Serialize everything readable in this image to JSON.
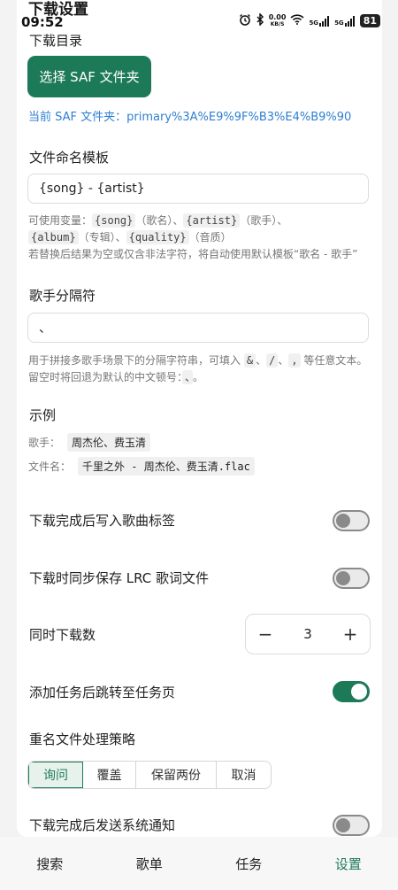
{
  "status_bar": {
    "time": "09:52",
    "net_speed_value": "0.00",
    "net_speed_unit": "KB/S",
    "signal_1": "5G",
    "signal_2": "5G",
    "battery": "81"
  },
  "page": {
    "title": "下载设置"
  },
  "download_dir": {
    "label": "下载目录",
    "button_label": "选择 SAF 文件夹",
    "current_path": "当前 SAF 文件夹：primary%3A%E9%9F%B3%E4%B9%90"
  },
  "naming_template": {
    "label": "文件命名模板",
    "value": "{song} - {artist}",
    "help_prefix": "可使用变量：",
    "var_song": "{song}",
    "var_song_desc": "（歌名）、",
    "var_artist": "{artist}",
    "var_artist_desc": "（歌手）、",
    "var_album": "{album}",
    "var_album_desc": "（专辑）、",
    "var_quality": "{quality}",
    "var_quality_desc": "（音质）",
    "help_fallback": "若替换后结果为空或仅含非法字符，将自动使用默认模板“歌名 - 歌手”"
  },
  "artist_separator": {
    "label": "歌手分隔符",
    "value": "、",
    "help_prefix": "用于拼接多歌手场景下的分隔字符串，可填入",
    "sep_amp": "&",
    "sep_slash": "/",
    "sep_comma": ",",
    "help_suffix": "等任意文本。",
    "help_empty_prefix": "留空时将回退为默认的中文顿号：",
    "sep_default": "、",
    "help_empty_suffix": "。"
  },
  "example": {
    "label": "示例",
    "artist_label": "歌手：",
    "artist_value": "周杰伦、费玉清",
    "filename_label": "文件名：",
    "filename_value": "千里之外 - 周杰伦、费玉清.flac"
  },
  "settings": {
    "write_tags_label": "下载完成后写入歌曲标签",
    "write_tags_on": false,
    "save_lrc_label": "下载时同步保存 LRC 歌词文件",
    "save_lrc_on": false,
    "concurrent_label": "同时下载数",
    "concurrent_minus": "−",
    "concurrent_value": "3",
    "concurrent_plus": "+",
    "jump_tasks_label": "添加任务后跳转至任务页",
    "jump_tasks_on": true,
    "rename_label": "重名文件处理策略",
    "rename_options": [
      "询问",
      "覆盖",
      "保留两份",
      "取消"
    ],
    "rename_selected": "询问",
    "notify_label": "下载完成后发送系统通知",
    "notify_on": false
  },
  "colors": {
    "accent": "#1d7a58",
    "link": "#2f7fd0"
  },
  "bottom_nav": {
    "items": [
      "搜索",
      "歌单",
      "任务",
      "设置"
    ],
    "active": "设置"
  }
}
